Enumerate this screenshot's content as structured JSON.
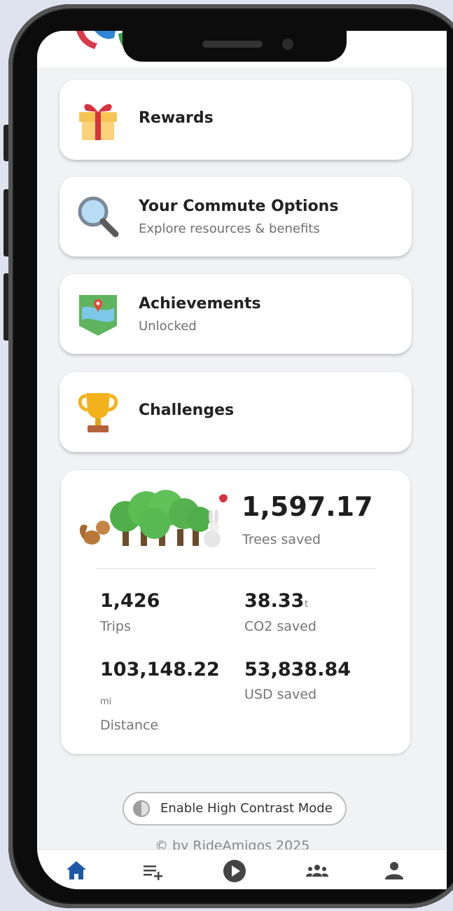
{
  "cards": {
    "rewards": {
      "title": "Rewards"
    },
    "commute": {
      "title": "Your Commute Options",
      "subtitle": "Explore resources & benefits"
    },
    "achievements": {
      "title": "Achievements",
      "subtitle": "Unlocked"
    },
    "challenges": {
      "title": "Challenges"
    }
  },
  "stats": {
    "trees_value": "1,597.17",
    "trees_label": "Trees saved",
    "trips_value": "1,426",
    "trips_label": "Trips",
    "co2_value": "38.33",
    "co2_unit": "t",
    "co2_label": "CO2 saved",
    "distance_value": "103,148.22",
    "distance_unit": "mi",
    "distance_label": "Distance",
    "usd_value": "53,838.84",
    "usd_label": "USD saved"
  },
  "contrast_button": {
    "label": "Enable High Contrast Mode"
  },
  "footer": {
    "text": "© by RideAmigos 2025"
  },
  "nav": {
    "items": [
      {
        "icon": "home-icon",
        "active": true
      },
      {
        "icon": "playlist-add-icon",
        "active": false
      },
      {
        "icon": "play-circle-icon",
        "active": false
      },
      {
        "icon": "groups-icon",
        "active": false
      },
      {
        "icon": "person-icon",
        "active": false
      }
    ]
  },
  "colors": {
    "active_nav": "#1c5aa8",
    "inactive_nav": "#444444",
    "card_bg": "#ffffff",
    "screen_bg": "#f1f2f4"
  }
}
